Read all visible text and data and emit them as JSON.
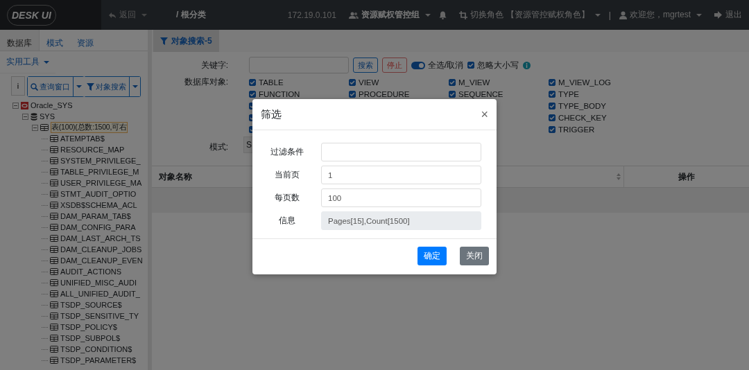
{
  "topbar": {
    "logo": "DESK UI",
    "back": "返回",
    "breadcrumb": "/ 根分类",
    "ip": "172.19.0.101",
    "group": "资源赋权管控组",
    "switch_role": "切换角色",
    "role": "【资源管控赋权角色】",
    "separator": "|",
    "welcome": "欢迎您，mgrtest",
    "logout": "退出"
  },
  "sidebar": {
    "tabs": [
      {
        "label": "数据库",
        "selected": true
      },
      {
        "label": "模式",
        "selected": false
      },
      {
        "label": "资源",
        "selected": false
      }
    ],
    "tools_menu": "实用工具",
    "info_button": "i",
    "query_button": "查询窗口",
    "search_button": "对象搜索",
    "tree": [
      {
        "label": "Oracle_SYS",
        "kind": "connection",
        "expanded": true,
        "children": [
          {
            "label": "SYS",
            "kind": "schema",
            "expanded": true,
            "children": [
              {
                "label": "表(100)(总数:1500,可右",
                "kind": "folder",
                "expanded": true,
                "selected": true,
                "children": [
                  {
                    "label": "ATEMPTAB$",
                    "kind": "table"
                  },
                  {
                    "label": "RESOURCE_MAP",
                    "kind": "table"
                  },
                  {
                    "label": "SYSTEM_PRIVILEGE_",
                    "kind": "table"
                  },
                  {
                    "label": "TABLE_PRIVILEGE_M",
                    "kind": "table"
                  },
                  {
                    "label": "USER_PRIVILEGE_MA",
                    "kind": "table"
                  },
                  {
                    "label": "STMT_AUDIT_OPTIO",
                    "kind": "table"
                  },
                  {
                    "label": "XSDB$SCHEMA_ACL",
                    "kind": "table"
                  },
                  {
                    "label": "DAM_PARAM_TAB$",
                    "kind": "table"
                  },
                  {
                    "label": "DAM_CONFIG_PARA",
                    "kind": "table"
                  },
                  {
                    "label": "DAM_LAST_ARCH_TS",
                    "kind": "table"
                  },
                  {
                    "label": "DAM_CLEANUP_JOBS",
                    "kind": "table"
                  },
                  {
                    "label": "DAM_CLEANUP_EVEN",
                    "kind": "table"
                  },
                  {
                    "label": "AUDIT_ACTIONS",
                    "kind": "table"
                  },
                  {
                    "label": "UNIFIED_MISC_AUDI",
                    "kind": "table"
                  },
                  {
                    "label": "ALL_UNIFIED_AUDIT_",
                    "kind": "table"
                  },
                  {
                    "label": "TSDP_SOURCE$",
                    "kind": "table"
                  },
                  {
                    "label": "TSDP_SENSITIVE_TY",
                    "kind": "table"
                  },
                  {
                    "label": "TSDP_POLICY$",
                    "kind": "table"
                  },
                  {
                    "label": "TSDP_SUBPOL$",
                    "kind": "table"
                  },
                  {
                    "label": "TSDP_CONDITION$",
                    "kind": "table"
                  },
                  {
                    "label": "TSDP_PARAMETER$",
                    "kind": "table"
                  }
                ]
              }
            ]
          }
        ]
      }
    ]
  },
  "main": {
    "tabs": [
      {
        "label": "对象搜索-5",
        "selected": true
      }
    ],
    "keyword_label": "关键字:",
    "search_button": "搜索",
    "stop_button": "停止",
    "select_all": {
      "label": "全选/取消",
      "on": true
    },
    "ignore_case": {
      "label": "忽略大小写",
      "checked": true
    },
    "objects_label": "数据库对象:",
    "object_columns": [
      [
        {
          "label": "TABLE",
          "checked": true
        },
        {
          "label": "FUNCTION",
          "checked": true
        },
        {
          "checked": true
        },
        {
          "checked": true
        },
        {
          "checked": true
        }
      ],
      [
        {
          "label": "VIEW",
          "checked": true
        },
        {
          "label": "PROCEDURE",
          "checked": true
        }
      ],
      [
        {
          "label": "M_VIEW",
          "checked": true
        },
        {
          "label": "SEQUENCE",
          "checked": true
        }
      ],
      [
        {
          "label": "M_VIEW_LOG",
          "checked": true
        },
        {
          "label": "TYPE",
          "checked": true
        },
        {
          "label": "TYPE_BODY",
          "checked": true
        },
        {
          "label": "CHECK_KEY",
          "checked": true
        },
        {
          "label": "TRIGGER",
          "checked": true
        }
      ]
    ],
    "mode_label": "模式:",
    "mode_value": "S",
    "table": {
      "columns": [
        "对象名称",
        "操作"
      ]
    }
  },
  "dialog": {
    "title": "筛选",
    "close": "×",
    "fields": [
      {
        "label": "过滤条件",
        "disabled": false
      },
      {
        "label": "当前页",
        "value": "1",
        "disabled": false
      },
      {
        "label": "每页数",
        "value": "100",
        "disabled": false
      },
      {
        "label": "信息",
        "value": "Pages[15],Count[1500]",
        "disabled": true
      }
    ],
    "buttons": [
      {
        "label": "确定",
        "kind": "primary"
      },
      {
        "label": "关闭",
        "kind": "secondary"
      }
    ]
  }
}
